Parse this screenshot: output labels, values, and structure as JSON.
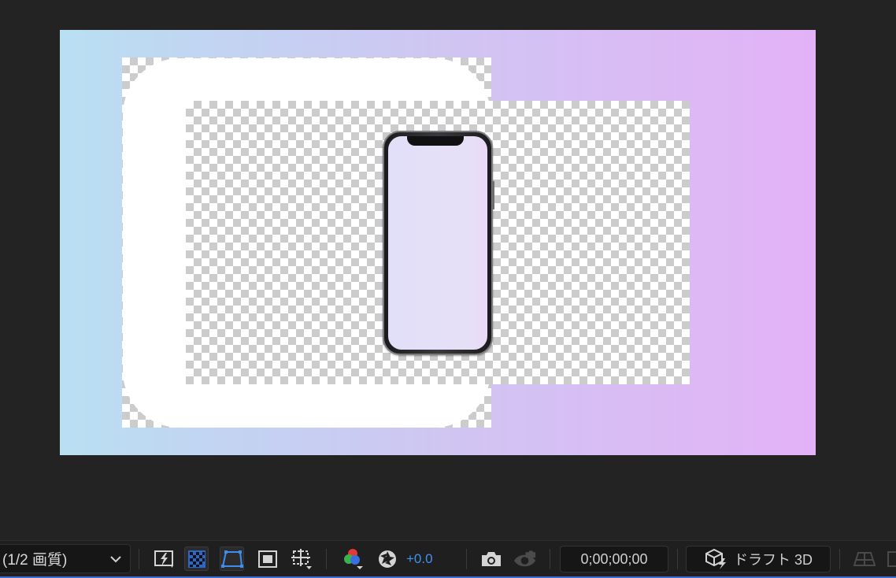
{
  "toolbar": {
    "quality_label": "(1/2 画質)",
    "exposure_value": "+0.0",
    "timecode": "0;00;00;00",
    "draft3d_label": "ドラフト 3D"
  },
  "colors": {
    "accent": "#3d93f0",
    "comp_gradient_start": "#b9dff2",
    "comp_gradient_end": "#e3b2f6"
  },
  "icons": [
    "chevron-down-icon",
    "fast-preview-icon",
    "transparency-grid-icon",
    "mask-path-icon",
    "region-of-interest-icon",
    "guides-icon",
    "channels-icon",
    "reset-exposure-icon",
    "snapshot-icon",
    "show-snapshot-icon",
    "draft-3d-icon",
    "3d-ground-plane-icon"
  ]
}
